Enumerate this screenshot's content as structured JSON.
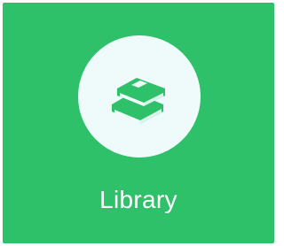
{
  "tile": {
    "label": "Library",
    "icon": "books-icon",
    "background_color": "#2ec16a",
    "icon_circle_color": "#effbfb",
    "icon_color": "#2ec16a",
    "label_color": "#ffffff"
  }
}
